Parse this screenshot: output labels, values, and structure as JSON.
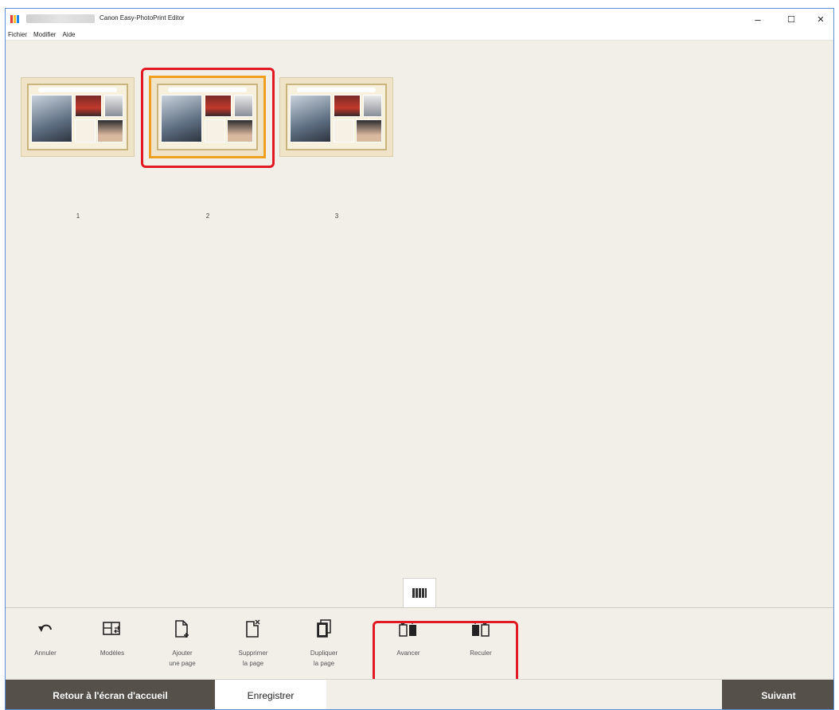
{
  "window": {
    "title": "Canon Easy-PhotoPrint Editor",
    "controls": {
      "minimize": "–",
      "maximize": "☐",
      "close": "✕"
    },
    "logo_colors": [
      "#e53935",
      "#fbc02d",
      "#1e88e5"
    ]
  },
  "menu": {
    "items": [
      "Fichier",
      "Modifier",
      "Aide"
    ]
  },
  "pages": [
    {
      "number": "1",
      "selected": false
    },
    {
      "number": "2",
      "selected": true
    },
    {
      "number": "3",
      "selected": false
    }
  ],
  "panel_toggle": {
    "icon": "filmstrip-icon"
  },
  "toolbar": {
    "items": [
      {
        "icon": "undo-icon",
        "label": "Annuler"
      },
      {
        "icon": "templates-icon",
        "label": "Modèles"
      },
      {
        "icon": "add-page-icon",
        "label": "Ajouter\nune page"
      },
      {
        "icon": "delete-page-icon",
        "label": "Supprimer\nla page"
      },
      {
        "icon": "duplicate-page-icon",
        "label": "Dupliquer\nla page"
      },
      {
        "icon": "move-forward-icon",
        "label": "Avancer"
      },
      {
        "icon": "move-backward-icon",
        "label": "Reculer"
      }
    ]
  },
  "footer": {
    "home_label": "Retour à l'écran d'accueil",
    "save_label": "Enregistrer",
    "next_label": "Suivant"
  },
  "colors": {
    "highlight": "#e01a24",
    "selection": "#f0a020",
    "dark_button": "#55504a"
  }
}
